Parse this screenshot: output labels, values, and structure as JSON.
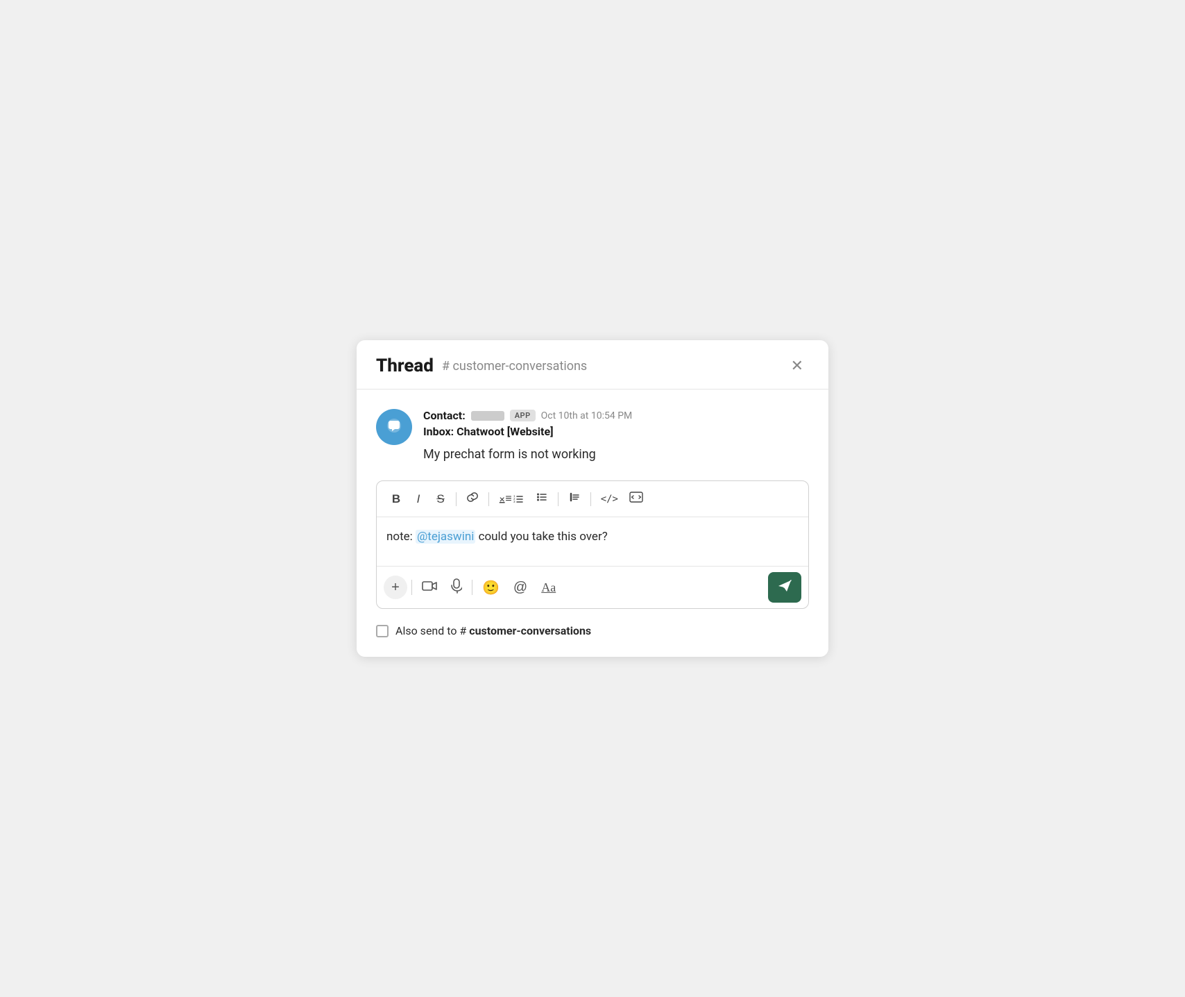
{
  "header": {
    "title": "Thread",
    "channel": "# customer-conversations",
    "close_label": "×"
  },
  "message": {
    "contact_label": "Contact:",
    "app_badge": "APP",
    "timestamp": "Oct 10th at 10:54 PM",
    "inbox_label": "Inbox: Chatwoot [Website]",
    "message_text": "My prechat form is not working"
  },
  "compose": {
    "text_before": "note: ",
    "mention": "@tejaswini",
    "text_after": " could you take this over?"
  },
  "toolbar": {
    "bold": "B",
    "italic": "I",
    "strike": "S"
  },
  "also_send": {
    "label": "Also send to ",
    "hash": "# ",
    "channel": "customer-conversations"
  }
}
